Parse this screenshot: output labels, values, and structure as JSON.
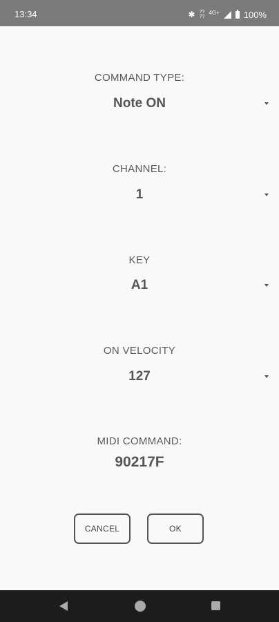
{
  "status_bar": {
    "time": "13:34",
    "network_top": "??",
    "network_bottom": "??",
    "network_type": "4G+",
    "battery": "100%"
  },
  "fields": {
    "command_type": {
      "label": "COMMAND TYPE:",
      "value": "Note ON"
    },
    "channel": {
      "label": "CHANNEL:",
      "value": "1"
    },
    "key": {
      "label": "KEY",
      "value": "A1"
    },
    "velocity": {
      "label": "ON VELOCITY",
      "value": "127"
    }
  },
  "midi_command": {
    "label": "MIDI COMMAND:",
    "value": "90217F"
  },
  "buttons": {
    "cancel": "CANCEL",
    "ok": "OK"
  },
  "icons": {
    "bluetooth": "bluetooth-icon",
    "signal": "signal-icon",
    "battery": "battery-icon",
    "dropdown": "dropdown-arrow-icon",
    "back": "back-icon",
    "home": "home-icon",
    "recents": "recents-icon"
  }
}
